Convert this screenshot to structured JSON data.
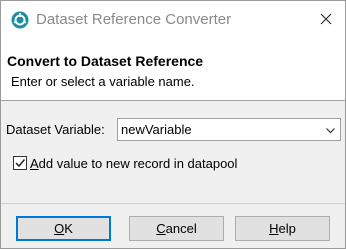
{
  "window": {
    "title": "Dataset Reference Converter",
    "icons": {
      "app": "app-logo-icon",
      "close": "close-icon"
    }
  },
  "banner": {
    "title": "Convert to Dataset Reference",
    "message": "Enter or select a variable name."
  },
  "form": {
    "variable_label": "Dataset Variable:",
    "variable_value": "newVariable",
    "dropdown_icon": "chevron-down-icon",
    "checkbox_checked": true,
    "checkbox_label_mnemonic": "A",
    "checkbox_label_rest": "dd value to new record in datapool"
  },
  "buttons": {
    "ok": {
      "mnemonic": "O",
      "rest": "K"
    },
    "cancel": {
      "mnemonic": "C",
      "rest": "ancel"
    },
    "help": {
      "mnemonic": "H",
      "rest": "elp"
    }
  },
  "colors": {
    "accent": "#0078d7",
    "app_icon": "#1e8fa3",
    "panel_bg": "#f0f0f0",
    "title_text": "#8a8a8a"
  }
}
